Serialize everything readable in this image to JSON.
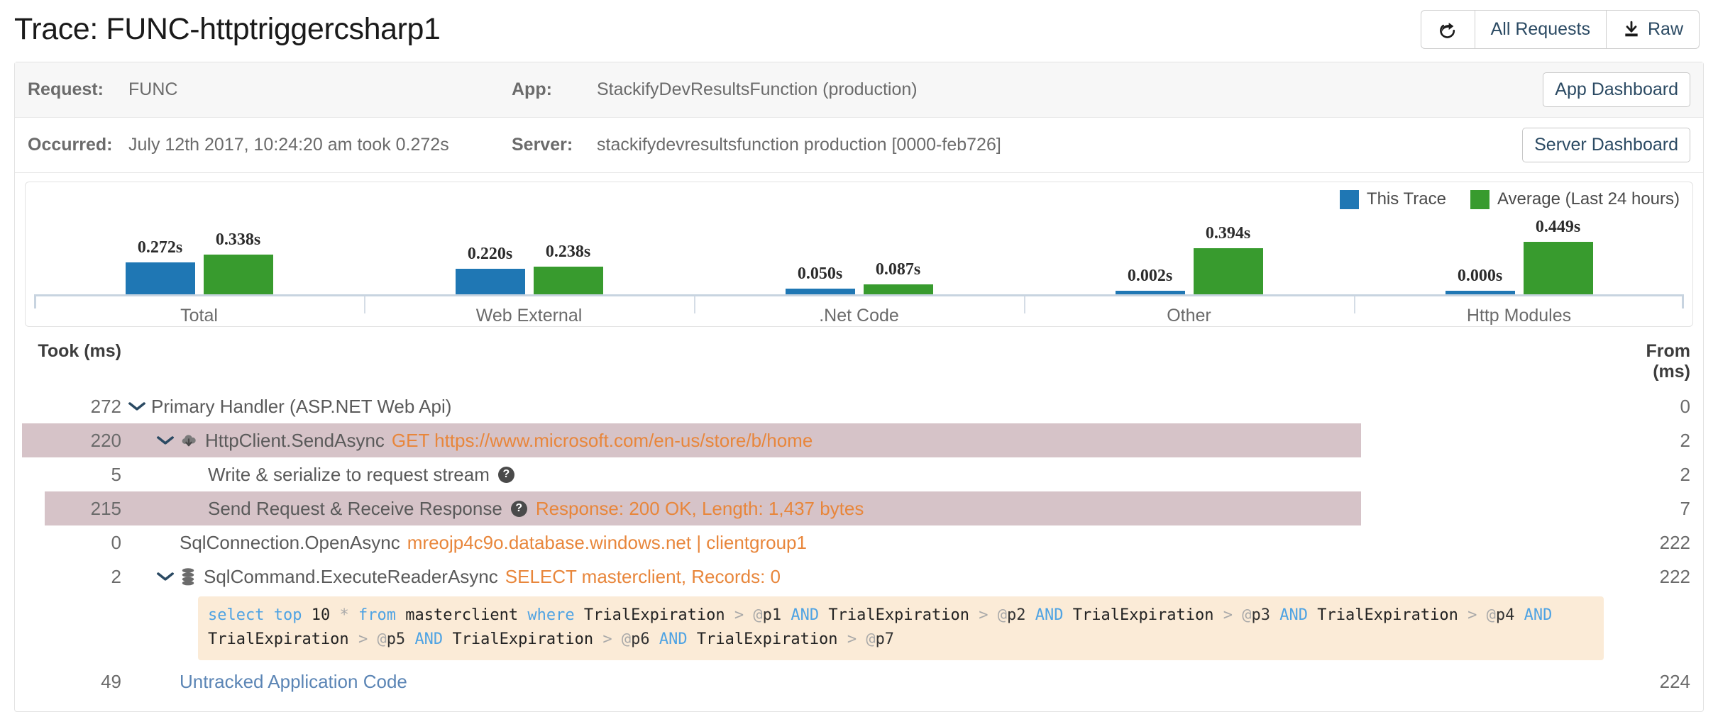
{
  "header": {
    "title": "Trace: FUNC-httptriggercsharp1",
    "buttons": [
      {
        "name": "share-button",
        "label": "",
        "icon": "share-icon"
      },
      {
        "name": "all-requests-button",
        "label": "All Requests",
        "icon": ""
      },
      {
        "name": "raw-button",
        "label": "Raw",
        "icon": "download-icon"
      }
    ]
  },
  "info": {
    "request_label": "Request:",
    "request_value": "FUNC",
    "app_label": "App:",
    "app_value": "StackifyDevResultsFunction (production)",
    "app_dashboard_button": "App Dashboard",
    "occurred_label": "Occurred:",
    "occurred_value": "July 12th 2017, 10:24:20 am took 0.272s",
    "server_label": "Server:",
    "server_value": "stackifydevresultsfunction production [0000-feb726]",
    "server_dashboard_button": "Server Dashboard"
  },
  "chart_data": {
    "type": "bar",
    "title": "",
    "xlabel": "",
    "ylabel": "",
    "categories": [
      "Total",
      "Web External",
      ".Net Code",
      "Other",
      "Http Modules"
    ],
    "series": [
      {
        "name": "This Trace",
        "color": "#1f77b4",
        "values": [
          0.272,
          0.22,
          0.05,
          0.002,
          0.0
        ]
      },
      {
        "name": "Average (Last 24 hours)",
        "color": "#389b2e",
        "values": [
          0.338,
          0.238,
          0.087,
          0.394,
          0.449
        ]
      }
    ],
    "value_labels": [
      [
        "0.272s",
        "0.338s"
      ],
      [
        "0.220s",
        "0.238s"
      ],
      [
        "0.050s",
        "0.087s"
      ],
      [
        "0.002s",
        "0.394s"
      ],
      [
        "0.000s",
        "0.449s"
      ]
    ],
    "ylim": [
      0,
      0.46
    ],
    "unit": "s",
    "grid": false,
    "legend_position": "top-right",
    "legend": [
      "This Trace",
      "Average (Last 24 hours)"
    ]
  },
  "trace": {
    "col_took": "Took (ms)",
    "col_from": "From (ms)",
    "rows": [
      {
        "took": "272",
        "from": "0",
        "indent": 1,
        "caret": true,
        "icon": "",
        "name": "Primary Handler (ASP.NET Web Api)",
        "detail": "",
        "highlight": "none"
      },
      {
        "took": "220",
        "from": "2",
        "indent": 2,
        "caret": true,
        "icon": "cloud-download-icon",
        "name": "HttpClient.SendAsync",
        "detail": "GET https://www.microsoft.com/en-us/store/b/home",
        "highlight": "a"
      },
      {
        "took": "5",
        "from": "2",
        "indent": 3,
        "caret": false,
        "icon": "",
        "name": "Write & serialize to request stream",
        "help": true,
        "detail": "",
        "highlight": "none"
      },
      {
        "took": "215",
        "from": "7",
        "indent": 3,
        "caret": false,
        "icon": "",
        "name": "Send Request & Receive Response",
        "help": true,
        "detail": "Response: 200 OK, Length: 1,437 bytes",
        "highlight": "b"
      },
      {
        "took": "0",
        "from": "222",
        "indent": 2,
        "caret": false,
        "icon": "",
        "name": "SqlConnection.OpenAsync",
        "detail": "mreojp4c9o.database.windows.net | clientgroup1",
        "highlight": "none"
      },
      {
        "took": "2",
        "from": "222",
        "indent": 2,
        "caret": true,
        "icon": "database-icon",
        "name": "SqlCommand.ExecuteReaderAsync",
        "detail": "SELECT masterclient, Records: 0",
        "highlight": "none"
      },
      {
        "took": "49",
        "from": "224",
        "indent": 2,
        "caret": false,
        "icon": "",
        "name": "Untracked Application Code",
        "link": true,
        "detail": "",
        "highlight": "none"
      }
    ],
    "sql": {
      "text": "select top 10 * from masterclient where TrialExpiration > @p1 AND TrialExpiration > @p2 AND TrialExpiration > @p3 AND TrialExpiration > @p4 AND TrialExpiration > @p5 AND TrialExpiration > @p6 AND TrialExpiration > @p7"
    }
  },
  "colors": {
    "this_trace": "#1f77b4",
    "average": "#389b2e",
    "highlight_row": "#d6c3c8",
    "sql_bg": "#fbebd7",
    "detail_orange": "#e8863b",
    "link_blue": "#5b85b5"
  }
}
